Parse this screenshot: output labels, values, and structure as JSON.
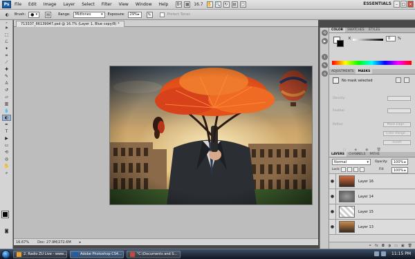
{
  "menubar": {
    "logo": "Ps",
    "items": [
      "File",
      "Edit",
      "Image",
      "Layer",
      "Select",
      "Filter",
      "View",
      "Window",
      "Help"
    ],
    "zoom": "16.7",
    "workspace": "ESSENTIALS"
  },
  "options": {
    "tool_label": "Brush:",
    "range_label": "Range:",
    "range_value": "Midtones",
    "exposure_label": "Exposure:",
    "exposure_value": "29%",
    "protect_tones": "Protect Tones"
  },
  "document": {
    "tab_title": "713337_66139947.psd @ 16.7% (Layer 1, Blue copy/8) *",
    "status_zoom": "16.67%",
    "status_doc": "Doc: 27.9M/272.6M"
  },
  "color_panel": {
    "tabs": [
      "COLOR",
      "SWATCHES",
      "STYLES"
    ],
    "channel_label": "K",
    "channel_value": "0",
    "percent": "%"
  },
  "adjustments_panel": {
    "tabs": [
      "ADJUSTMENTS",
      "MASKS"
    ],
    "mask_status": "No mask selected",
    "density_label": "Density:",
    "feather_label": "Feather:",
    "refine_label": "Refine:",
    "mask_edge": "Mask Edge...",
    "color_range": "Color Range...",
    "invert": "Invert"
  },
  "layers_panel": {
    "tabs": [
      "LAYERS",
      "CHANNELS",
      "PATHS"
    ],
    "blend_mode": "Normal",
    "opacity_label": "Opacity:",
    "opacity_value": "100%",
    "lock_label": "Lock:",
    "fill_label": "Fill:",
    "fill_value": "100%",
    "layers": [
      {
        "name": "Layer 16"
      },
      {
        "name": "Layer 14"
      },
      {
        "name": "Layer 15"
      },
      {
        "name": "Layer 13"
      }
    ]
  },
  "taskbar": {
    "items": [
      {
        "label": "2. Radio ZU Live - www..."
      },
      {
        "label": "Adobe Photoshop CS4..."
      },
      {
        "label": "\"C:\\Documents and S..."
      }
    ],
    "clock": "11:15 PM"
  },
  "colors": {
    "accent": "#1b5fa5",
    "sky": "#d7b36a",
    "tree": "#e3501a"
  }
}
